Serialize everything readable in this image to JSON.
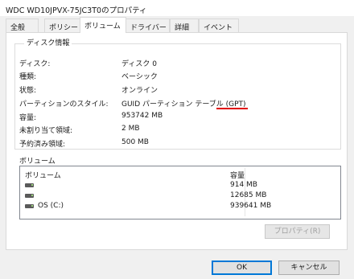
{
  "window": {
    "title": "WDC WD10JPVX-75JC3T0のプロパティ"
  },
  "tabs": [
    {
      "label": "全般"
    },
    {
      "label": "ポリシー"
    },
    {
      "label": "ボリューム"
    },
    {
      "label": "ドライバー"
    },
    {
      "label": "詳細"
    },
    {
      "label": "イベント"
    }
  ],
  "disk_info": {
    "group_title": "ディスク情報",
    "rows": [
      {
        "label": "ディスク:",
        "value": "ディスク 0"
      },
      {
        "label": "種類:",
        "value": "ベーシック"
      },
      {
        "label": "状態:",
        "value": "オンライン"
      },
      {
        "label": "パーティションのスタイル:",
        "value": "GUID パーティション テーブル (GPT)"
      },
      {
        "label": "容量:",
        "value": "953742 MB"
      },
      {
        "label": "未割り当て領域:",
        "value": "2 MB"
      },
      {
        "label": "予約済み領域:",
        "value": "500 MB"
      }
    ]
  },
  "volumes": {
    "section_title": "ボリューム",
    "headers": {
      "volume": "ボリューム",
      "capacity": "容量"
    },
    "rows": [
      {
        "name": "",
        "capacity": "914 MB"
      },
      {
        "name": "",
        "capacity": "12685 MB"
      },
      {
        "name": "OS (C:)",
        "capacity": "939641 MB"
      }
    ],
    "properties_button": "プロパティ(R)"
  },
  "footer": {
    "ok_label": "OK",
    "cancel_label": "キャンセル"
  },
  "colors": {
    "accent": "#0078d7",
    "highlight": "#e00000"
  }
}
